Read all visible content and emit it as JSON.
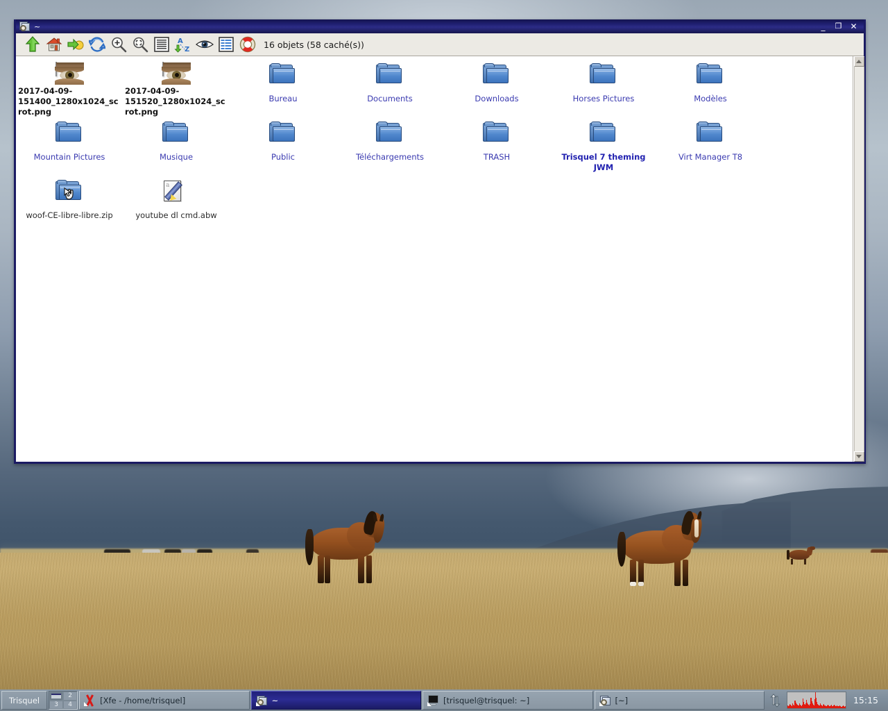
{
  "window": {
    "title": "~",
    "icon": "xfe-window-icon",
    "controls": {
      "minimize": "_",
      "maximize": "❐",
      "close": "✕"
    }
  },
  "toolbar": {
    "buttons": [
      {
        "name": "go-up-icon",
        "tooltip": "Up"
      },
      {
        "name": "home-icon",
        "tooltip": "Home"
      },
      {
        "name": "go-to-icon",
        "tooltip": "Go to"
      },
      {
        "name": "refresh-icon",
        "tooltip": "Refresh"
      },
      {
        "name": "zoom-in-icon",
        "tooltip": "Zoom in"
      },
      {
        "name": "zoom-fit-icon",
        "tooltip": "Zoom to fit"
      },
      {
        "name": "big-icons-view-icon",
        "tooltip": "Icon list"
      },
      {
        "name": "sort-az-icon",
        "tooltip": "Sort A to Z"
      },
      {
        "name": "show-hidden-eye-icon",
        "tooltip": "Show hidden files"
      },
      {
        "name": "detailed-list-icon",
        "tooltip": "Detailed file list"
      },
      {
        "name": "help-lifebuoy-icon",
        "tooltip": "Help"
      }
    ],
    "status": "16 objets (58 caché(s))"
  },
  "files": [
    {
      "label": "2017-04-09-151400_1280x1024_scrot.png",
      "type": "image",
      "style": "file"
    },
    {
      "label": "2017-04-09-151520_1280x1024_scrot.png",
      "type": "image",
      "style": "file"
    },
    {
      "label": "Bureau",
      "type": "folder",
      "style": "link"
    },
    {
      "label": "Documents",
      "type": "folder",
      "style": "link"
    },
    {
      "label": "Downloads",
      "type": "folder",
      "style": "link"
    },
    {
      "label": "Horses Pictures",
      "type": "folder",
      "style": "link"
    },
    {
      "label": "Modèles",
      "type": "folder",
      "style": "link"
    },
    {
      "label": "Mountain Pictures",
      "type": "folder",
      "style": "link"
    },
    {
      "label": "Musique",
      "type": "folder",
      "style": "link"
    },
    {
      "label": "Public",
      "type": "folder",
      "style": "link"
    },
    {
      "label": "Téléchargements",
      "type": "folder",
      "style": "link"
    },
    {
      "label": "TRASH",
      "type": "folder",
      "style": "link"
    },
    {
      "label": "Trisquel 7 theming JWM",
      "type": "folder",
      "style": "boldlink"
    },
    {
      "label": "Virt Manager T8",
      "type": "folder",
      "style": "link"
    },
    {
      "label": "woof-CE-libre-libre.zip",
      "type": "archive",
      "style": "plain"
    },
    {
      "label": "youtube dl cmd.abw",
      "type": "document",
      "style": "plain"
    }
  ],
  "scrollbar": {
    "up": "▲",
    "down": "▼"
  },
  "taskbar": {
    "start_label": "Trisquel",
    "pager": {
      "desktops": [
        "1",
        "2",
        "3",
        "4"
      ],
      "active": "1"
    },
    "tasks": [
      {
        "label": "[Xfe - /home/trisquel]",
        "icon": "x-close-icon",
        "active": false
      },
      {
        "label": "~",
        "icon": "xfe-window-icon",
        "active": true
      },
      {
        "label": "[trisquel@trisquel: ~]",
        "icon": "terminal-icon",
        "active": false
      },
      {
        "label": "[~]",
        "icon": "xfe-window-icon",
        "active": false
      }
    ],
    "tray": {
      "network_icon": "network-up-down-icon",
      "monitor_graph": {
        "name": "network-monitor-graph",
        "color": "#e01b10",
        "background": "#c0c0c0",
        "samples": [
          8,
          6,
          7,
          12,
          9,
          7,
          6,
          14,
          10,
          8,
          22,
          16,
          11,
          9,
          8,
          7,
          13,
          10,
          8,
          6,
          9,
          28,
          18,
          12,
          9,
          14,
          24,
          16,
          11,
          9,
          8,
          12,
          30,
          20,
          14,
          10,
          8,
          26,
          45,
          30,
          18,
          12,
          9,
          8,
          7,
          14,
          10,
          8,
          6,
          9,
          12,
          8,
          7,
          6,
          8,
          10,
          7,
          6,
          5,
          7,
          9,
          6,
          5,
          7,
          10,
          7,
          5,
          6,
          8,
          6,
          5,
          6,
          7,
          5,
          4,
          6,
          8,
          5,
          4,
          6
        ]
      },
      "clock": "15:15"
    }
  },
  "wallpaper": {
    "name": "horses-grassland-photo",
    "sky_color": "#a9b5c0",
    "field_color": "#bfa469",
    "mountain_color": "#44586e"
  }
}
